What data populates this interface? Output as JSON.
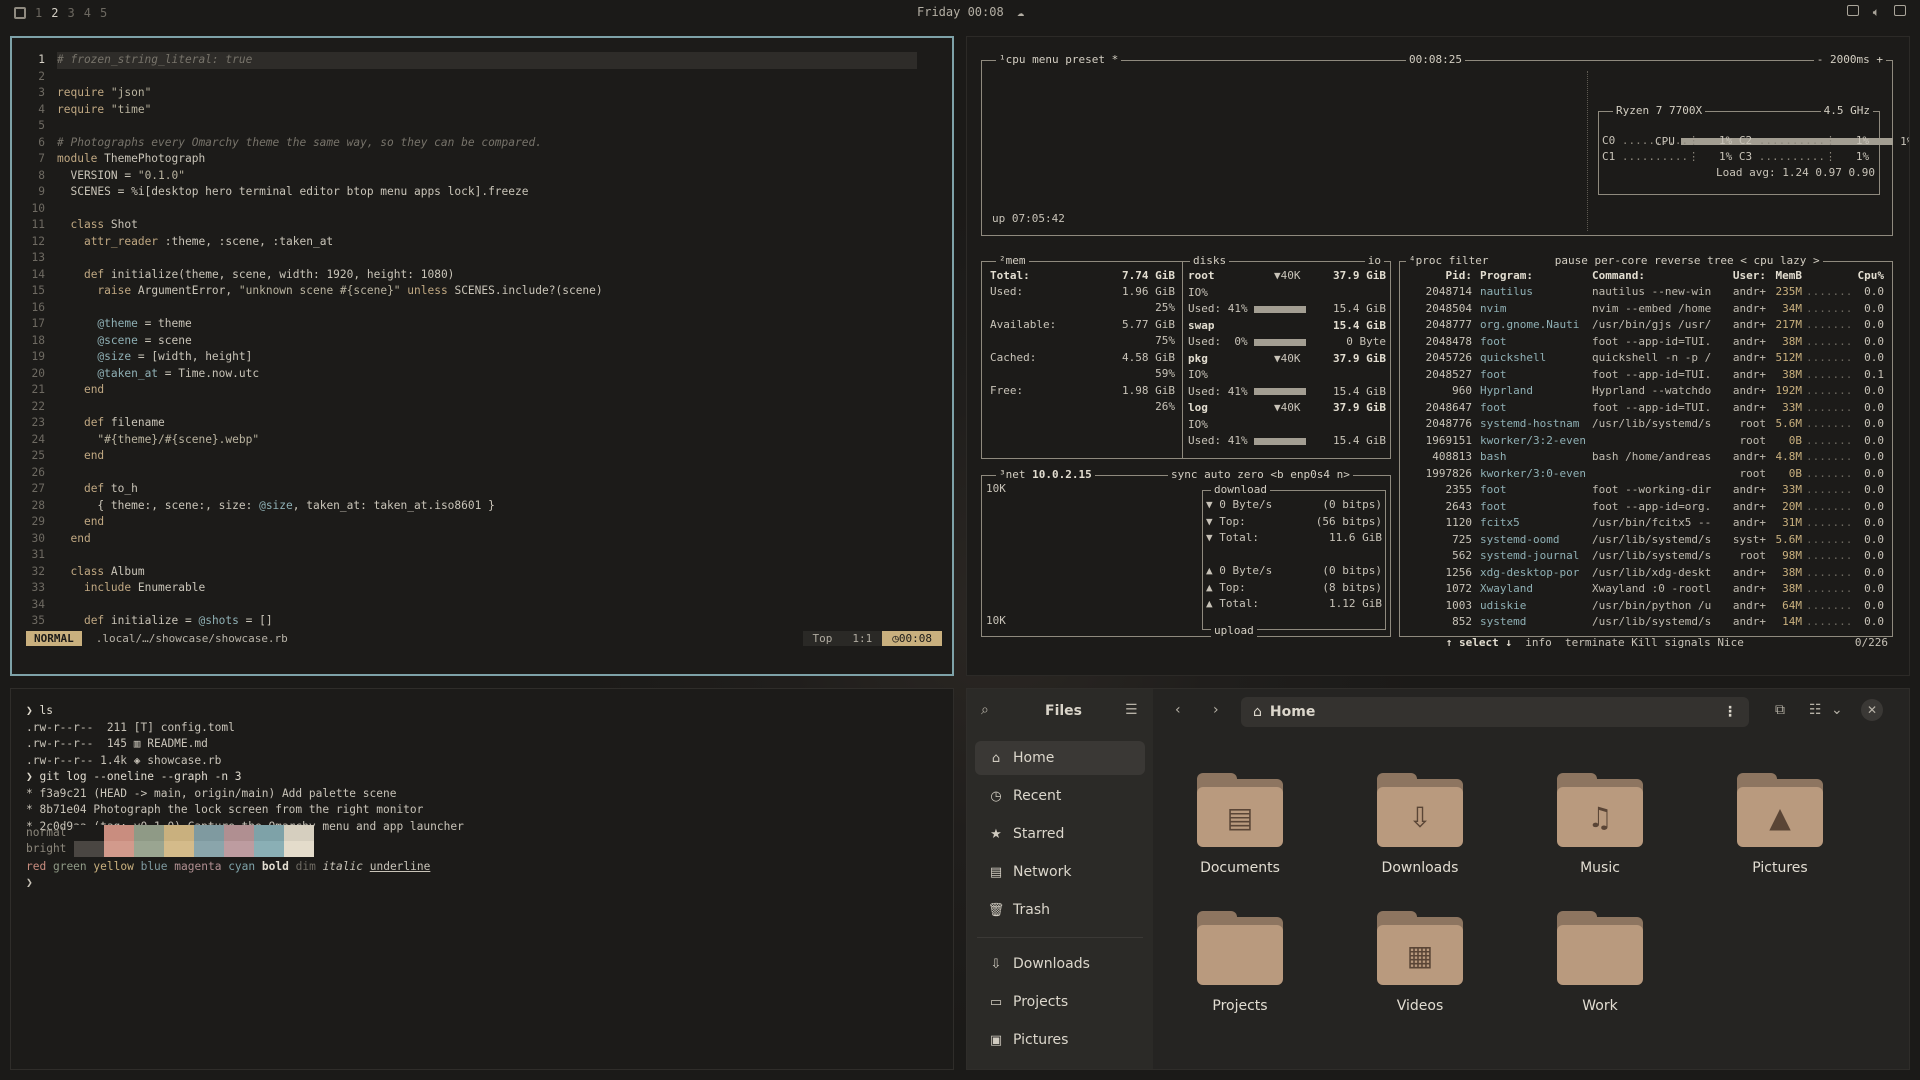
{
  "topbar": {
    "workspaces": [
      "1",
      "2",
      "3",
      "4",
      "5"
    ],
    "active_workspace": "2",
    "clock": "Friday 00:08"
  },
  "editor": {
    "lines": [
      {
        "n": "1",
        "t": "# frozen_string_literal: true"
      },
      {
        "n": "2",
        "t": ""
      },
      {
        "n": "3",
        "t": "require \"json\""
      },
      {
        "n": "4",
        "t": "require \"time\""
      },
      {
        "n": "5",
        "t": ""
      },
      {
        "n": "6",
        "t": "# Photographs every Omarchy theme the same way, so they can be compared."
      },
      {
        "n": "7",
        "t": "module ThemePhotograph"
      },
      {
        "n": "8",
        "t": "  VERSION = \"0.1.0\""
      },
      {
        "n": "9",
        "t": "  SCENES = %i[desktop hero terminal editor btop menu apps lock].freeze"
      },
      {
        "n": "10",
        "t": ""
      },
      {
        "n": "11",
        "t": "  class Shot"
      },
      {
        "n": "12",
        "t": "    attr_reader :theme, :scene, :taken_at"
      },
      {
        "n": "13",
        "t": ""
      },
      {
        "n": "14",
        "t": "    def initialize(theme, scene, width: 1920, height: 1080)"
      },
      {
        "n": "15",
        "t": "      raise ArgumentError, \"unknown scene #{scene}\" unless SCENES.include?(scene)"
      },
      {
        "n": "16",
        "t": ""
      },
      {
        "n": "17",
        "t": "      @theme = theme"
      },
      {
        "n": "18",
        "t": "      @scene = scene"
      },
      {
        "n": "19",
        "t": "      @size = [width, height]"
      },
      {
        "n": "20",
        "t": "      @taken_at = Time.now.utc"
      },
      {
        "n": "21",
        "t": "    end"
      },
      {
        "n": "22",
        "t": ""
      },
      {
        "n": "23",
        "t": "    def filename"
      },
      {
        "n": "24",
        "t": "      \"#{theme}/#{scene}.webp\""
      },
      {
        "n": "25",
        "t": "    end"
      },
      {
        "n": "26",
        "t": ""
      },
      {
        "n": "27",
        "t": "    def to_h"
      },
      {
        "n": "28",
        "t": "      { theme:, scene:, size: @size, taken_at: taken_at.iso8601 }"
      },
      {
        "n": "29",
        "t": "    end"
      },
      {
        "n": "30",
        "t": "  end"
      },
      {
        "n": "31",
        "t": ""
      },
      {
        "n": "32",
        "t": "  class Album"
      },
      {
        "n": "33",
        "t": "    include Enumerable"
      },
      {
        "n": "34",
        "t": ""
      },
      {
        "n": "35",
        "t": "    def initialize = @shots = []"
      }
    ],
    "status": {
      "mode": "NORMAL",
      "path": ".local/…/showcase/showcase.rb",
      "position": "Top",
      "cursor": "1:1",
      "time": "00:08"
    }
  },
  "btop": {
    "cpu": {
      "label": "¹cpu",
      "menu": "menu",
      "preset": "preset *",
      "clock": "00:08:25",
      "rate": "- 2000ms +",
      "uptime": "up 07:05:42",
      "model": "Ryzen 7 7700X",
      "freq": "4.5 GHz",
      "total_label": "CPU",
      "total": "1%",
      "cores": [
        {
          "name": "C0",
          "val": "1%"
        },
        {
          "name": "C2",
          "val": "1%"
        },
        {
          "name": "C1",
          "val": "1%"
        },
        {
          "name": "C3",
          "val": "1%"
        }
      ],
      "load": "Load avg: 1.24 0.97 0.90"
    },
    "mem": {
      "label": "²mem",
      "disks_label": "disks",
      "io_label": "io",
      "total_label": "Total:",
      "total": "7.74 GiB",
      "used_label": "Used:",
      "used": "1.96 GiB",
      "used_pct": "25%",
      "avail_label": "Available:",
      "avail": "5.77 GiB",
      "avail_pct": "75%",
      "cached_label": "Cached:",
      "cached": "4.58 GiB",
      "cached_pct": "59%",
      "free_label": "Free:",
      "free": "1.98 GiB",
      "free_pct": "26%",
      "disks": [
        {
          "name": "root",
          "io": "▼40K",
          "size": "37.9 GiB",
          "io_label": "IO%",
          "used": "Used: 41%",
          "used_size": "15.4 GiB"
        },
        {
          "name": "swap",
          "io": "",
          "size": "15.4 GiB",
          "io_label": "",
          "used": "Used:  0%",
          "used_size": "0 Byte"
        },
        {
          "name": "pkg",
          "io": "▼40K",
          "size": "37.9 GiB",
          "io_label": "IO%",
          "used": "Used: 41%",
          "used_size": "15.4 GiB"
        },
        {
          "name": "log",
          "io": "▼40K",
          "size": "37.9 GiB",
          "io_label": "IO%",
          "used": "Used: 41%",
          "used_size": "15.4 GiB"
        }
      ]
    },
    "net": {
      "label": "³net",
      "ip": "10.0.2.15",
      "sync": "sync",
      "auto": "auto",
      "zero": "zero",
      "iface": "<b enp0s4 n>",
      "scale_top": "10K",
      "scale_bottom": "10K",
      "download_label": "download",
      "upload_label": "upload",
      "down": [
        {
          "k": "▼ 0 Byte/s",
          "v": "(0 bitps)"
        },
        {
          "k": "▼ Top:",
          "v": "(56 bitps)"
        },
        {
          "k": "▼ Total:",
          "v": "11.6 GiB"
        }
      ],
      "up": [
        {
          "k": "▲ 0 Byte/s",
          "v": "(0 bitps)"
        },
        {
          "k": "▲ Top:",
          "v": "(8 bitps)"
        },
        {
          "k": "▲ Total:",
          "v": "1.12 GiB"
        }
      ]
    },
    "proc": {
      "label": "⁴proc",
      "filter": "filter",
      "pause": "pause",
      "percore": "per-core",
      "reverse": "reverse",
      "tree": "tree",
      "sort": "< cpu lazy >",
      "headers": {
        "pid": "Pid:",
        "prog": "Program:",
        "cmd": "Command:",
        "user": "User:",
        "mem": "MemB",
        "cpu": "Cpu%"
      },
      "rows": [
        {
          "pid": "2048714",
          "prog": "nautilus",
          "cmd": "nautilus --new-win",
          "user": "andr+",
          "mem": "235M",
          "cpu": "0.0"
        },
        {
          "pid": "2048504",
          "prog": "nvim",
          "cmd": "nvim --embed /home",
          "user": "andr+",
          "mem": "34M",
          "cpu": "0.0"
        },
        {
          "pid": "2048777",
          "prog": "org.gnome.Nauti",
          "cmd": "/usr/bin/gjs /usr/",
          "user": "andr+",
          "mem": "217M",
          "cpu": "0.0"
        },
        {
          "pid": "2048478",
          "prog": "foot",
          "cmd": "foot --app-id=TUI.",
          "user": "andr+",
          "mem": "38M",
          "cpu": "0.0"
        },
        {
          "pid": "2045726",
          "prog": "quickshell",
          "cmd": "quickshell -n -p /",
          "user": "andr+",
          "mem": "512M",
          "cpu": "0.0"
        },
        {
          "pid": "2048527",
          "prog": "foot",
          "cmd": "foot --app-id=TUI.",
          "user": "andr+",
          "mem": "38M",
          "cpu": "0.1"
        },
        {
          "pid": "960",
          "prog": "Hyprland",
          "cmd": "Hyprland --watchdo",
          "user": "andr+",
          "mem": "192M",
          "cpu": "0.0"
        },
        {
          "pid": "2048647",
          "prog": "foot",
          "cmd": "foot --app-id=TUI.",
          "user": "andr+",
          "mem": "33M",
          "cpu": "0.0"
        },
        {
          "pid": "2048776",
          "prog": "systemd-hostnam",
          "cmd": "/usr/lib/systemd/s",
          "user": "root",
          "mem": "5.6M",
          "cpu": "0.0"
        },
        {
          "pid": "1969151",
          "prog": "kworker/3:2-even",
          "cmd": "",
          "user": "root",
          "mem": "0B",
          "cpu": "0.0"
        },
        {
          "pid": "408813",
          "prog": "bash",
          "cmd": "bash /home/andreas",
          "user": "andr+",
          "mem": "4.8M",
          "cpu": "0.0"
        },
        {
          "pid": "1997826",
          "prog": "kworker/3:0-even",
          "cmd": "",
          "user": "root",
          "mem": "0B",
          "cpu": "0.0"
        },
        {
          "pid": "2355",
          "prog": "foot",
          "cmd": "foot --working-dir",
          "user": "andr+",
          "mem": "33M",
          "cpu": "0.0"
        },
        {
          "pid": "2643",
          "prog": "foot",
          "cmd": "foot --app-id=org.",
          "user": "andr+",
          "mem": "20M",
          "cpu": "0.0"
        },
        {
          "pid": "1120",
          "prog": "fcitx5",
          "cmd": "/usr/bin/fcitx5 --",
          "user": "andr+",
          "mem": "31M",
          "cpu": "0.0"
        },
        {
          "pid": "725",
          "prog": "systemd-oomd",
          "cmd": "/usr/lib/systemd/s",
          "user": "syst+",
          "mem": "5.6M",
          "cpu": "0.0"
        },
        {
          "pid": "562",
          "prog": "systemd-journal",
          "cmd": "/usr/lib/systemd/s",
          "user": "root",
          "mem": "98M",
          "cpu": "0.0"
        },
        {
          "pid": "1256",
          "prog": "xdg-desktop-por",
          "cmd": "/usr/lib/xdg-deskt",
          "user": "andr+",
          "mem": "38M",
          "cpu": "0.0"
        },
        {
          "pid": "1072",
          "prog": "Xwayland",
          "cmd": "Xwayland :0 -rootl",
          "user": "andr+",
          "mem": "38M",
          "cpu": "0.0"
        },
        {
          "pid": "1003",
          "prog": "udiskie",
          "cmd": "/usr/bin/python /u",
          "user": "andr+",
          "mem": "64M",
          "cpu": "0.0"
        },
        {
          "pid": "852",
          "prog": "systemd",
          "cmd": "/usr/lib/systemd/s",
          "user": "andr+",
          "mem": "14M",
          "cpu": "0.0"
        }
      ],
      "footer": {
        "select": "↑ select ↓",
        "info": "info",
        "terminate": "terminate",
        "kill": "Kill",
        "signals": "signals",
        "nice": "Nice",
        "count": "0/226"
      }
    }
  },
  "terminal": {
    "lines": [
      "❯ ls",
      ".rw-r--r--  211 [T] config.toml",
      ".rw-r--r--  145 ▥ README.md",
      ".rw-r--r-- 1.4k ◈ showcase.rb",
      "❯ git log --oneline --graph -n 3",
      "* f3a9c21 (HEAD -> main, origin/main) Add palette scene",
      "* 8b71e04 Photograph the lock screen from the right monitor",
      "* 2c0d9aa (tag: v0.1.0) Capture the Omarchy menu and app launcher"
    ],
    "normal_label": "normal",
    "bright_label": "bright",
    "normal_colors": [
      "#1c1b19",
      "#c98d7f",
      "#8f9a86",
      "#c9b07e",
      "#7f9aa0",
      "#b08f91",
      "#7ea2a8",
      "#d6cfbf"
    ],
    "bright_colors": [
      "#4a4642",
      "#d29a8c",
      "#9aa591",
      "#d4bb8a",
      "#8aa5ab",
      "#bd9ca0",
      "#8aafb5",
      "#e4dccb"
    ],
    "styles": [
      "red",
      "green",
      "yellow",
      "blue",
      "magenta",
      "cyan",
      "bold",
      "dim",
      "italic",
      "underline"
    ],
    "prompt": "❯"
  },
  "files": {
    "title": "Files",
    "location": "Home",
    "sidebar": [
      "Home",
      "Recent",
      "Starred",
      "Network",
      "Trash"
    ],
    "bookmarks": [
      "Downloads",
      "Projects",
      "Pictures"
    ],
    "folders": [
      {
        "name": "Documents",
        "icon": "document-icon"
      },
      {
        "name": "Downloads",
        "icon": "download-icon"
      },
      {
        "name": "Music",
        "icon": "music-icon"
      },
      {
        "name": "Pictures",
        "icon": "picture-icon"
      },
      {
        "name": "Projects",
        "icon": "folder-icon"
      },
      {
        "name": "Videos",
        "icon": "film-icon"
      },
      {
        "name": "Work",
        "icon": "folder-icon"
      }
    ]
  }
}
